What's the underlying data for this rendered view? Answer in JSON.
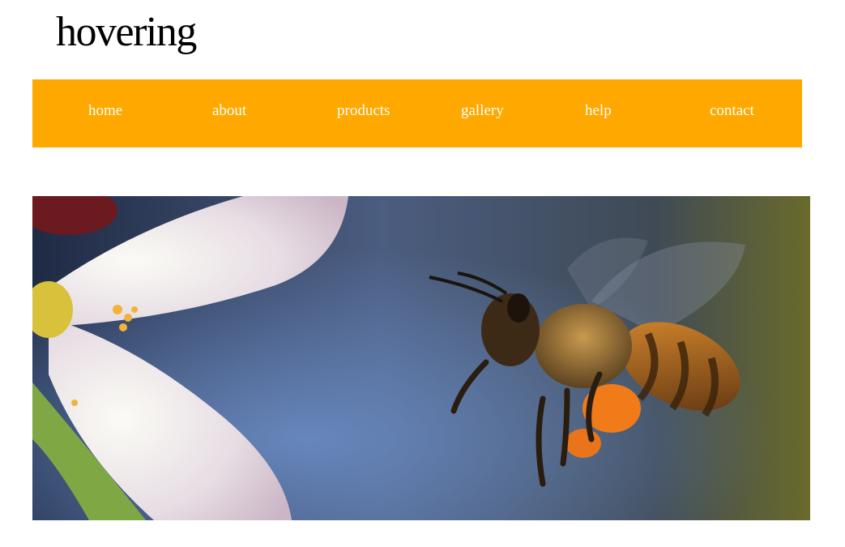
{
  "site": {
    "title": "hovering"
  },
  "nav": {
    "background": "#ffa800",
    "text_color": "#ffffff",
    "items": [
      {
        "label": "home"
      },
      {
        "label": "about"
      },
      {
        "label": "products"
      },
      {
        "label": "gallery"
      },
      {
        "label": "help"
      },
      {
        "label": "contact"
      }
    ]
  },
  "hero": {
    "icon": "bee-photo-icon"
  }
}
